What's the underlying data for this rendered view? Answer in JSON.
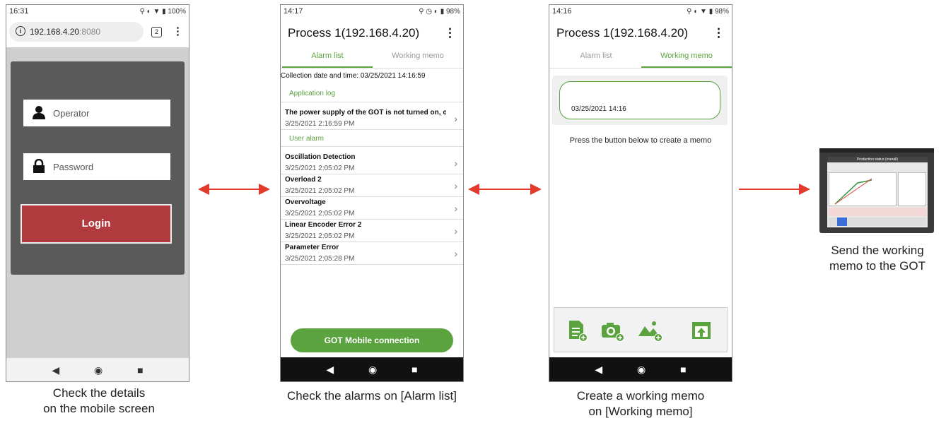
{
  "phone1": {
    "status_time": "16:31",
    "status_battery": "100%",
    "url_host": "192.168.4.20",
    "url_port": ":8080",
    "tab_count": "2",
    "operator_placeholder": "Operator",
    "password_placeholder": "Password",
    "login_label": "Login"
  },
  "phone2": {
    "status_time": "14:17",
    "status_battery": "98%",
    "title": "Process 1(192.168.4.20)",
    "tabs": [
      "Alarm list",
      "Working memo"
    ],
    "collection_label": "Collection date and time:  03/25/2021 14:16:59",
    "app_log_header": "Application log",
    "app_log_items": [
      {
        "title": "The power supply of the GOT is not turned on, o...",
        "date": "3/25/2021 2:16:59 PM"
      }
    ],
    "user_alarm_header": "User alarm",
    "user_alarms": [
      {
        "title": "Oscillation Detection",
        "date": "3/25/2021 2:05:02 PM"
      },
      {
        "title": "Overload 2",
        "date": "3/25/2021 2:05:02 PM"
      },
      {
        "title": "Overvoltage",
        "date": "3/25/2021 2:05:02 PM"
      },
      {
        "title": "Linear Encoder Error 2",
        "date": "3/25/2021 2:05:02 PM"
      },
      {
        "title": "Parameter Error",
        "date": "3/25/2021 2:05:28 PM"
      }
    ],
    "connect_button": "GOT Mobile connection"
  },
  "phone3": {
    "status_time": "14:16",
    "status_battery": "98%",
    "title": "Process 1(192.168.4.20)",
    "tabs": [
      "Alarm list",
      "Working memo"
    ],
    "memo_date": "03/25/2021 14:16",
    "hint": "Press the button below to create a memo"
  },
  "got": {
    "screen_title": "Production status (overall)"
  },
  "captions": {
    "c1_line1": "Check the details",
    "c1_line2": "on the mobile screen",
    "c2": "Check the alarms on [Alarm list]",
    "c3_line1": "Create a working memo",
    "c3_line2": "on [Working memo]",
    "c4_line1": "Send the working",
    "c4_line2": "memo to the GOT"
  },
  "colors": {
    "accent_green": "#5aa33f",
    "login_red": "#b03a3e",
    "arrow_red": "#e23b2e",
    "panel_gray": "#5a5a5a"
  }
}
